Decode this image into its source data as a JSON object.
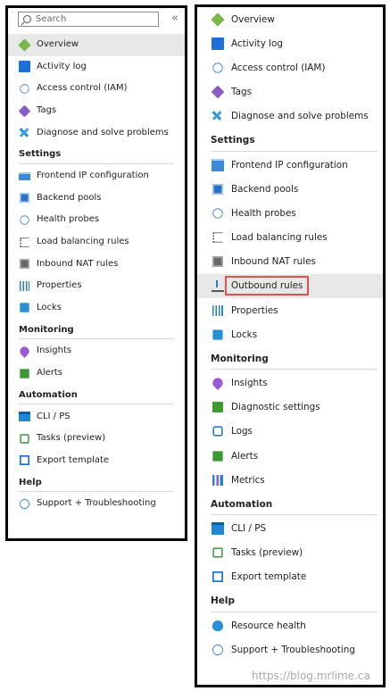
{
  "left_panel": {
    "search": {
      "placeholder": "Search"
    },
    "collapse_glyph": "«",
    "items_top": [
      {
        "label": "Overview",
        "icon": "overview-icon",
        "selected": true
      },
      {
        "label": "Activity log",
        "icon": "activity-log-icon"
      },
      {
        "label": "Access control (IAM)",
        "icon": "iam-icon"
      },
      {
        "label": "Tags",
        "icon": "tag-icon"
      },
      {
        "label": "Diagnose and solve problems",
        "icon": "wrench-icon"
      }
    ],
    "settings": {
      "title": "Settings",
      "items": [
        {
          "label": "Frontend IP configuration",
          "icon": "frontend-ip-icon"
        },
        {
          "label": "Backend pools",
          "icon": "backend-pools-icon"
        },
        {
          "label": "Health probes",
          "icon": "health-probe-icon"
        },
        {
          "label": "Load balancing rules",
          "icon": "rules-list-icon"
        },
        {
          "label": "Inbound NAT rules",
          "icon": "inbound-nat-icon"
        },
        {
          "label": "Properties",
          "icon": "properties-icon"
        },
        {
          "label": "Locks",
          "icon": "lock-icon"
        }
      ]
    },
    "monitoring": {
      "title": "Monitoring",
      "items": [
        {
          "label": "Insights",
          "icon": "insights-icon"
        },
        {
          "label": "Alerts",
          "icon": "alerts-icon"
        }
      ]
    },
    "automation": {
      "title": "Automation",
      "items": [
        {
          "label": "CLI / PS",
          "icon": "cli-icon"
        },
        {
          "label": "Tasks (preview)",
          "icon": "tasks-icon"
        },
        {
          "label": "Export template",
          "icon": "export-template-icon"
        }
      ]
    },
    "help": {
      "title": "Help",
      "items": [
        {
          "label": "Support + Troubleshooting",
          "icon": "support-icon"
        }
      ]
    }
  },
  "right_panel": {
    "items_top": [
      {
        "label": "Overview",
        "icon": "overview-icon"
      },
      {
        "label": "Activity log",
        "icon": "activity-log-icon"
      },
      {
        "label": "Access control (IAM)",
        "icon": "iam-icon"
      },
      {
        "label": "Tags",
        "icon": "tag-icon"
      },
      {
        "label": "Diagnose and solve problems",
        "icon": "wrench-icon"
      }
    ],
    "settings": {
      "title": "Settings",
      "items": [
        {
          "label": "Frontend IP configuration",
          "icon": "frontend-ip-icon"
        },
        {
          "label": "Backend pools",
          "icon": "backend-pools-icon"
        },
        {
          "label": "Health probes",
          "icon": "health-probe-icon"
        },
        {
          "label": "Load balancing rules",
          "icon": "rules-list-icon"
        },
        {
          "label": "Inbound NAT rules",
          "icon": "inbound-nat-icon"
        },
        {
          "label": "Outbound rules",
          "icon": "outbound-rules-icon",
          "highlighted": true
        },
        {
          "label": "Properties",
          "icon": "properties-icon"
        },
        {
          "label": "Locks",
          "icon": "lock-icon"
        }
      ]
    },
    "monitoring": {
      "title": "Monitoring",
      "items": [
        {
          "label": "Insights",
          "icon": "insights-icon"
        },
        {
          "label": "Diagnostic settings",
          "icon": "diagnostic-settings-icon"
        },
        {
          "label": "Logs",
          "icon": "logs-icon"
        },
        {
          "label": "Alerts",
          "icon": "alerts-icon"
        },
        {
          "label": "Metrics",
          "icon": "metrics-icon"
        }
      ]
    },
    "automation": {
      "title": "Automation",
      "items": [
        {
          "label": "CLI / PS",
          "icon": "cli-icon"
        },
        {
          "label": "Tasks (preview)",
          "icon": "tasks-icon"
        },
        {
          "label": "Export template",
          "icon": "export-template-icon"
        }
      ]
    },
    "help": {
      "title": "Help",
      "items": [
        {
          "label": "Resource health",
          "icon": "resource-health-icon"
        },
        {
          "label": "Support + Troubleshooting",
          "icon": "support-icon"
        }
      ]
    }
  },
  "watermark": "https://blog.mrlime.ca",
  "colors": {
    "highlight_border": "#d9534f",
    "selected_bg": "#e8e8e8",
    "panel_border": "#000000"
  }
}
